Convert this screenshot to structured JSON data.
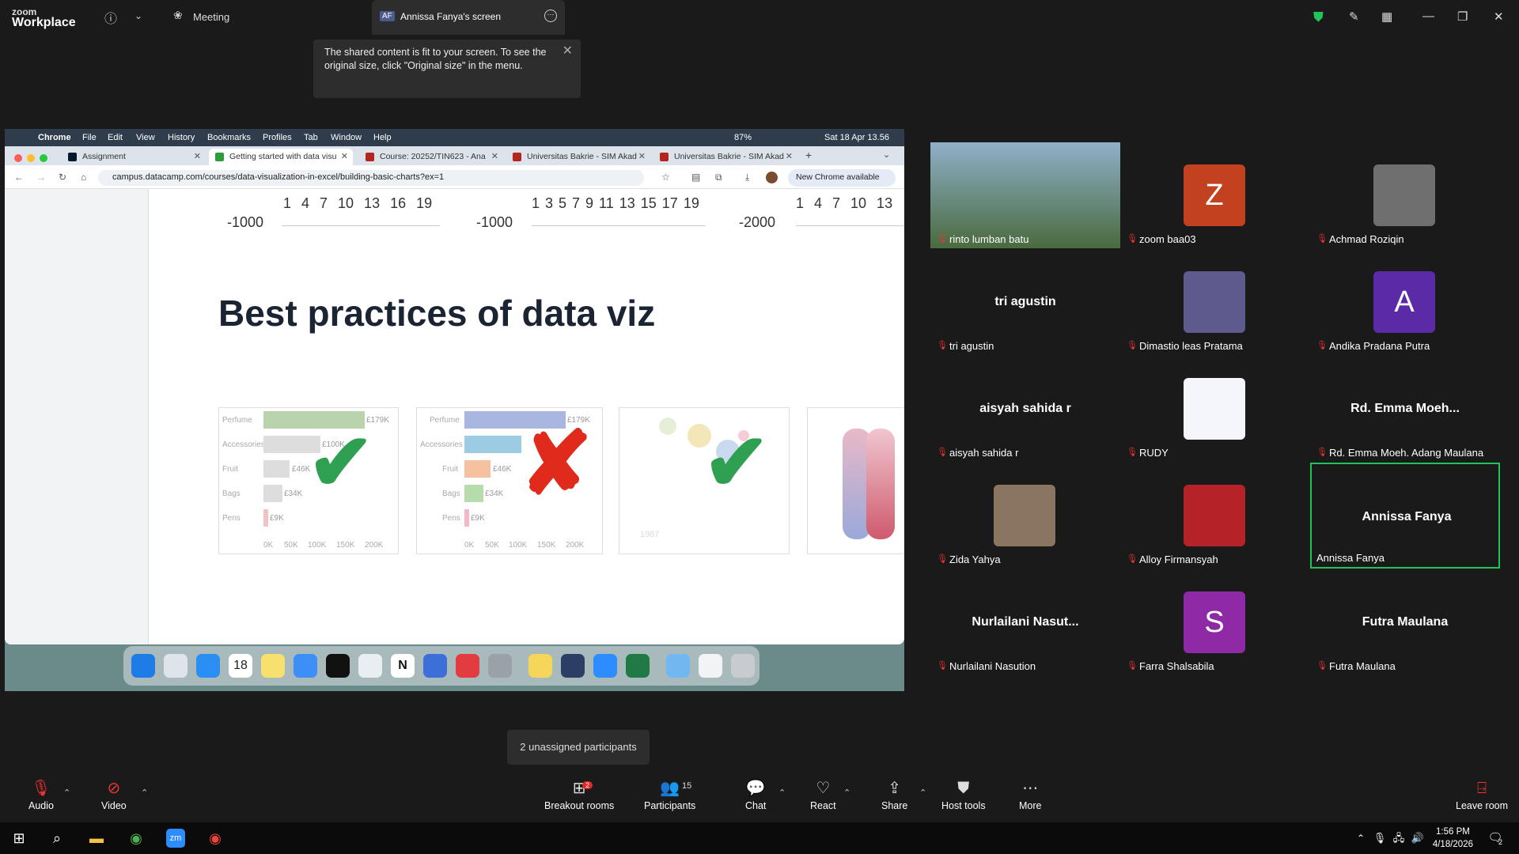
{
  "app": {
    "logo_line1": "zoom",
    "logo_line2": "Workplace"
  },
  "header": {
    "meeting_label": "Meeting",
    "share_initials": "AF",
    "share_title": "Annissa Fanya's screen"
  },
  "tooltip": {
    "text": "The shared content is fit to your screen. To see the original size, click \"Original size\" in the menu."
  },
  "shared": {
    "menubar": {
      "app": "Chrome",
      "items": [
        "File",
        "Edit",
        "View",
        "History",
        "Bookmarks",
        "Profiles",
        "Tab",
        "Window",
        "Help"
      ],
      "battery": "87%",
      "datetime": "Sat 18 Apr  13.56"
    },
    "tabs": [
      {
        "label": "Assignment",
        "color": "#05192d"
      },
      {
        "label": "Getting started with data visu",
        "color": "#2a9d3b"
      },
      {
        "label": "Course: 20252/TIN623 - Ana",
        "color": "#b3261e"
      },
      {
        "label": "Universitas Bakrie - SIM Akad",
        "color": "#b3261e"
      },
      {
        "label": "Universitas Bakrie - SIM Akad",
        "color": "#b3261e"
      }
    ],
    "url": "campus.datacamp.com/courses/data-visualization-in-excel/building-basic-charts?ex=1",
    "new_chrome": "New Chrome available",
    "axis_rows": [
      "1 4 7 10 13 16 19",
      "1 3 5 7 9 11 13 15 17 19",
      "1 4 7 10 13"
    ],
    "neg_labels": [
      "-1000",
      "-1000",
      "-2000"
    ],
    "heading": "Best practices of data viz",
    "card_a": {
      "labels": [
        "Perfume",
        "Accessories",
        "Fruit",
        "Bags",
        "Pens"
      ],
      "values": [
        "£179K",
        "£100K",
        "£46K",
        "£34K",
        "£9K"
      ],
      "axis": [
        "0K",
        "50K",
        "100K",
        "150K",
        "200K"
      ]
    },
    "card_c_year": "1987"
  },
  "participants": [
    {
      "tile_name": "",
      "label": "rinto lumban batu",
      "avatar": "photo",
      "color": "#5a7a4a"
    },
    {
      "tile_name": "",
      "label": "zoom baa03",
      "avatar": "Z",
      "color": "#c2411f"
    },
    {
      "tile_name": "",
      "label": "Achmad Roziqin",
      "avatar": "photo",
      "color": "#6f6f6f"
    },
    {
      "tile_name": "tri agustin",
      "label": "tri agustin",
      "avatar": "",
      "color": ""
    },
    {
      "tile_name": "",
      "label": "Dimastio leas Pratama",
      "avatar": "photo",
      "color": "#5f5a8e"
    },
    {
      "tile_name": "",
      "label": "Andika Pradana Putra",
      "avatar": "A",
      "color": "#5b2aa6"
    },
    {
      "tile_name": "aisyah sahida r",
      "label": "aisyah sahida r",
      "avatar": "",
      "color": ""
    },
    {
      "tile_name": "",
      "label": "RUDY",
      "avatar": "photo",
      "color": "#f4f6fb"
    },
    {
      "tile_name": "Rd.  Emma  Moeh...",
      "label": "Rd. Emma Moeh. Adang Maulana",
      "avatar": "",
      "color": ""
    },
    {
      "tile_name": "",
      "label": "Zida Yahya",
      "avatar": "photo",
      "color": "#8a7560"
    },
    {
      "tile_name": "",
      "label": "Alloy Firmansyah",
      "avatar": "photo",
      "color": "#b52228"
    },
    {
      "tile_name": "Annissa Fanya",
      "label": "Annissa Fanya",
      "avatar": "",
      "color": ""
    },
    {
      "tile_name": "Nurlailani  Nasut...",
      "label": "Nurlailani Nasution",
      "avatar": "",
      "color": ""
    },
    {
      "tile_name": "",
      "label": "Farra Shalsabila",
      "avatar": "S",
      "color": "#8e2aa6"
    },
    {
      "tile_name": "Futra Maulana",
      "label": "Futra Maulana",
      "avatar": "",
      "color": ""
    }
  ],
  "unassigned": "2 unassigned participants",
  "toolbar": {
    "audio": "Audio",
    "video": "Video",
    "breakout": "Breakout rooms",
    "breakout_badge": "2",
    "participants": "Participants",
    "participants_count": "15",
    "chat": "Chat",
    "react": "React",
    "share": "Share",
    "host_tools": "Host tools",
    "more": "More",
    "leave": "Leave room"
  },
  "taskbar": {
    "time": "1:56 PM",
    "date": "4/18/2026",
    "notif_count": "2"
  },
  "colors": {
    "accent_green": "#21c35a",
    "check_green": "#2fa052",
    "cross_red": "#e02a1c"
  }
}
